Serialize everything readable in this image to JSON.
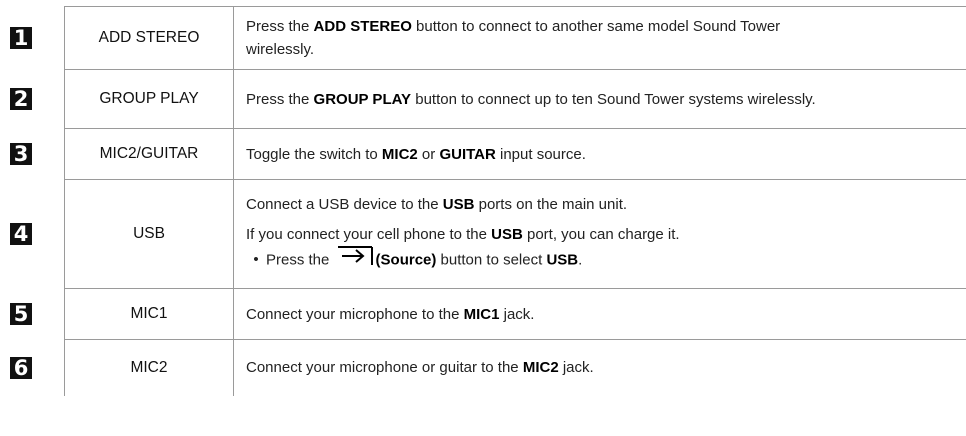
{
  "rows": [
    {
      "num": "1",
      "name": "ADD STEREO",
      "pre": "Press the ",
      "bold": "ADD STEREO",
      "post": " button to connect to another same model Sound Tower",
      "post2": "wirelessly."
    },
    {
      "num": "2",
      "name": "GROUP PLAY",
      "pre": "Press the ",
      "bold": "GROUP PLAY",
      "post": " button to connect up to ten Sound Tower systems wirelessly."
    },
    {
      "num": "3",
      "name": "MIC2/GUITAR",
      "pre": "Toggle the switch to ",
      "bold1": "MIC2",
      "mid": " or ",
      "bold2": "GUITAR",
      "post": " input source."
    },
    {
      "num": "4",
      "name": "USB",
      "l1_pre": "Connect a USB device to the ",
      "l1_bold": "USB",
      "l1_post": " ports on the main unit.",
      "l2_pre": "If you connect your cell phone to the ",
      "l2_bold": "USB",
      "l2_post": " port, you can charge it.",
      "bullet": "•",
      "l3_pre": "Press the ",
      "l3_icon": "source-arrow-icon",
      "l3_bold1": "(Source)",
      "l3_mid": " button to select ",
      "l3_bold2": "USB",
      "l3_post": "."
    },
    {
      "num": "5",
      "name": "MIC1",
      "pre": "Connect your microphone to the ",
      "bold": "MIC1",
      "post": " jack."
    },
    {
      "num": "6",
      "name": "MIC2",
      "pre": "Connect your microphone or guitar to the ",
      "bold": "MIC2",
      "post": " jack."
    }
  ]
}
